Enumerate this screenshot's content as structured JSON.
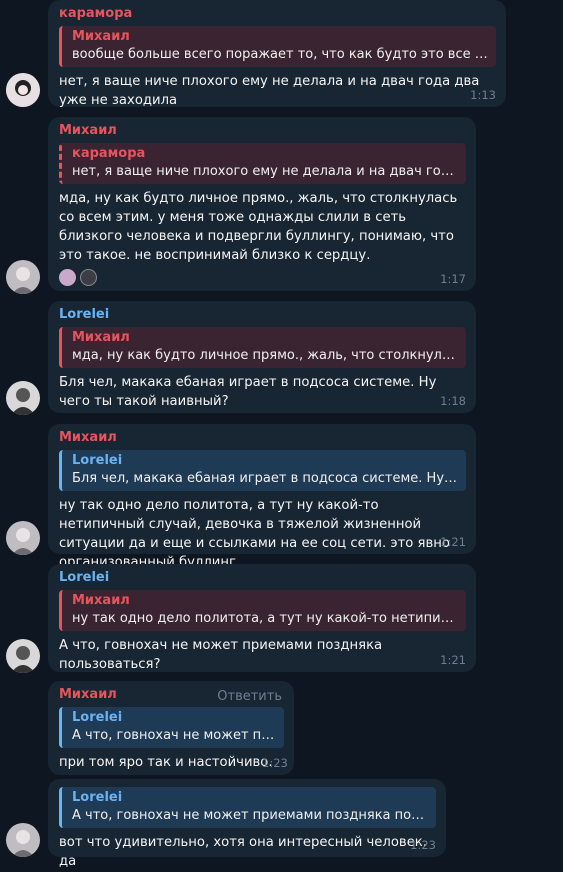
{
  "messages": [
    {
      "sender": "карамора",
      "reply_name": "Михаил",
      "reply_text": "вообще больше всего поражает то, что как будто это все пр...",
      "text": "нет, я ваще ниче плохого ему не делала и на двач года два уже не заходила",
      "time": "1:13"
    },
    {
      "sender": "Михаил",
      "reply_name": "карамора",
      "reply_text": "нет, я ваще ниче плохого ему не делала и на двач года два у...",
      "text": "мда, ну как будто личное прямо., жаль, что столкнулась со всем этим. у меня тоже однажды  слили в сеть близкого человека и подвергли буллингу, понимаю, что это такое. не воспринимай близко к сердцу.",
      "time": "1:17"
    },
    {
      "sender": "Lorelei",
      "reply_name": "Михаил",
      "reply_text": "мда, ну как будто личное прямо., жаль, что столкнулась со в...",
      "text": "Бля чел, макака ебаная играет в подсоса системе. Ну чего ты такой наивный?",
      "time": "1:18"
    },
    {
      "sender": "Михаил",
      "reply_name": "Lorelei",
      "reply_text": "Бля чел, макака ебаная играет в подсоса системе. Ну чего ты...",
      "text": "ну так одно дело политота, а тут ну какой-то нетипичный случай, девочка в тяжелой жизненной ситуации да и еще и ссылками на ее соц сети. это явно организованный буллинг",
      "time": "1:21"
    },
    {
      "sender": "Lorelei",
      "reply_name": "Михаил",
      "reply_text": "ну так одно дело политота, а тут ну какой-то нетипичный слу...",
      "text": "А что, говнохач не может приемами поздняка пользоваться?",
      "time": "1:21"
    },
    {
      "sender": "Михаил",
      "reply_action": "Ответить",
      "reply_name": "Lorelei",
      "reply_text": "А что, говнохач не может прие...",
      "text": "при том яро так и настойчиво.",
      "time": "1:23"
    },
    {
      "reply_name": "Lorelei",
      "reply_text": "А что, говнохач не может приемами поздняка пользов...",
      "text": "вот что удивительно, хотя она интересный человек. да",
      "time": "1:23"
    }
  ]
}
